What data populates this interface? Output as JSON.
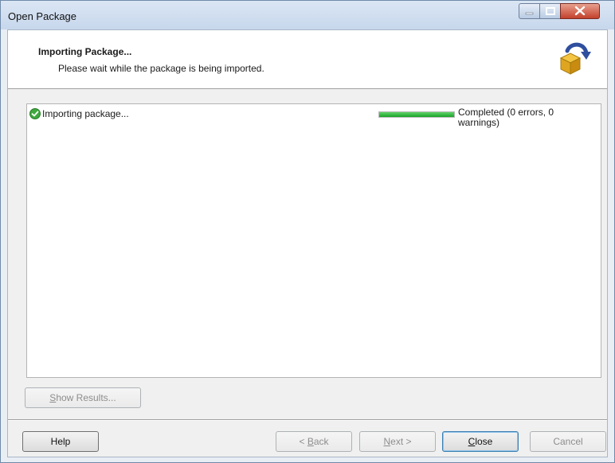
{
  "window": {
    "title": "Open Package"
  },
  "header": {
    "title": "Importing Package...",
    "subtitle": "Please wait while the package is being imported."
  },
  "task": {
    "label": "Importing package...",
    "status": "Completed (0 errors, 0 warnings)",
    "progress": 1.0,
    "state_icon": "success-check-icon"
  },
  "buttons": {
    "show_results": {
      "mnemonic": "S",
      "rest": "how Results..."
    },
    "help": "Help",
    "back": {
      "prefix": "< ",
      "mnemonic": "B",
      "rest": "ack"
    },
    "next": {
      "mnemonic": "N",
      "rest": "ext >"
    },
    "close": {
      "mnemonic": "C",
      "rest": "lose"
    },
    "cancel": "Cancel"
  },
  "colors": {
    "progress_fill": "#1aa328",
    "title_bar": "#c7d7ec",
    "close_button": "#c3412c"
  }
}
